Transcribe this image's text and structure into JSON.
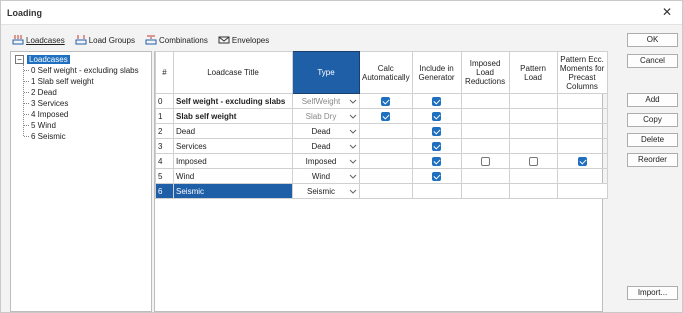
{
  "window": {
    "title": "Loading",
    "close_glyph": "✕"
  },
  "tabs": [
    {
      "label": "Loadcases",
      "icon": "loadcases-icon",
      "active": true
    },
    {
      "label": "Load Groups",
      "icon": "load-groups-icon",
      "active": false
    },
    {
      "label": "Combinations",
      "icon": "combinations-icon",
      "active": false
    },
    {
      "label": "Envelopes",
      "icon": "envelopes-icon",
      "active": false
    }
  ],
  "tree": {
    "root_label": "Loadcases",
    "expander": "−",
    "items": [
      "0 Self weight - excluding slabs",
      "1 Slab self weight",
      "2 Dead",
      "3 Services",
      "4 Imposed",
      "5 Wind",
      "6 Seismic"
    ]
  },
  "grid": {
    "headers": {
      "num": "#",
      "title": "Loadcase Title",
      "type": "Type",
      "calc": "Calc Automatically",
      "include": "Include in Generator",
      "reductions": "Imposed Load Reductions",
      "pattern": "Pattern Load",
      "pattern_ecc": "Pattern Ecc. Moments for Precast Columns"
    },
    "rows": [
      {
        "num": "0",
        "title": "Self weight - excluding slabs",
        "type": "SelfWeight",
        "type_dim": true,
        "bold": true,
        "calc": true,
        "include": true,
        "reductions": null,
        "pattern": null,
        "pattern_ecc": null,
        "selected": false
      },
      {
        "num": "1",
        "title": "Slab self weight",
        "type": "Slab Dry",
        "type_dim": true,
        "bold": true,
        "calc": true,
        "include": true,
        "reductions": null,
        "pattern": null,
        "pattern_ecc": null,
        "selected": false
      },
      {
        "num": "2",
        "title": "Dead",
        "type": "Dead",
        "type_dim": false,
        "bold": false,
        "calc": null,
        "include": true,
        "reductions": null,
        "pattern": null,
        "pattern_ecc": null,
        "selected": false
      },
      {
        "num": "3",
        "title": "Services",
        "type": "Dead",
        "type_dim": false,
        "bold": false,
        "calc": null,
        "include": true,
        "reductions": null,
        "pattern": null,
        "pattern_ecc": null,
        "selected": false
      },
      {
        "num": "4",
        "title": "Imposed",
        "type": "Imposed",
        "type_dim": false,
        "bold": false,
        "calc": null,
        "include": true,
        "reductions": false,
        "pattern": false,
        "pattern_ecc": true,
        "selected": false
      },
      {
        "num": "5",
        "title": "Wind",
        "type": "Wind",
        "type_dim": false,
        "bold": false,
        "calc": null,
        "include": true,
        "reductions": null,
        "pattern": null,
        "pattern_ecc": null,
        "selected": false
      },
      {
        "num": "6",
        "title": "Seismic",
        "type": "Seismic",
        "type_dim": false,
        "bold": false,
        "calc": null,
        "include": null,
        "reductions": null,
        "pattern": null,
        "pattern_ecc": null,
        "selected": true
      }
    ]
  },
  "buttons": {
    "ok": "OK",
    "cancel": "Cancel",
    "add": "Add",
    "copy": "Copy",
    "delete": "Delete",
    "reorder": "Reorder",
    "import": "Import..."
  },
  "colors": {
    "accent": "#1f5fa8",
    "check": "#1f6fc0"
  }
}
